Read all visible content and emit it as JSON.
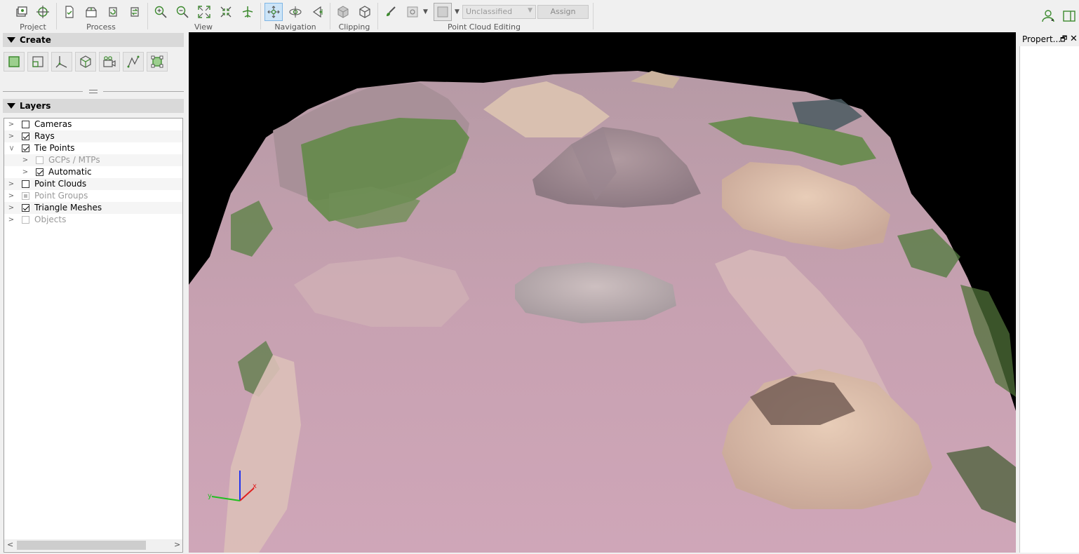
{
  "toolbar": {
    "groups": {
      "project": "Project",
      "process": "Process",
      "view": "View",
      "navigation": "Navigation",
      "clipping": "Clipping",
      "editing": "Point Cloud Editing"
    },
    "classification_value": "Unclassified",
    "assign_label": "Assign"
  },
  "create_panel": {
    "title": "Create"
  },
  "layers_panel": {
    "title": "Layers",
    "items": [
      {
        "label": "Cameras",
        "checked": false
      },
      {
        "label": "Rays",
        "checked": true
      },
      {
        "label": "Tie Points",
        "checked": true
      },
      {
        "label": "GCPs / MTPs",
        "checked": false
      },
      {
        "label": "Automatic",
        "checked": true
      },
      {
        "label": "Point Clouds",
        "checked": false
      },
      {
        "label": "Point Groups",
        "checked": false
      },
      {
        "label": "Triangle Meshes",
        "checked": true
      },
      {
        "label": "Objects",
        "checked": false
      }
    ]
  },
  "properties_panel": {
    "title": "Propert..."
  },
  "viewport": {
    "axis_labels": {
      "x": "x",
      "y": "y"
    }
  },
  "colors": {
    "terrain": "#c9a6b4",
    "vegetation": "#5a8a3a",
    "accent_green": "#3c8a2e"
  }
}
